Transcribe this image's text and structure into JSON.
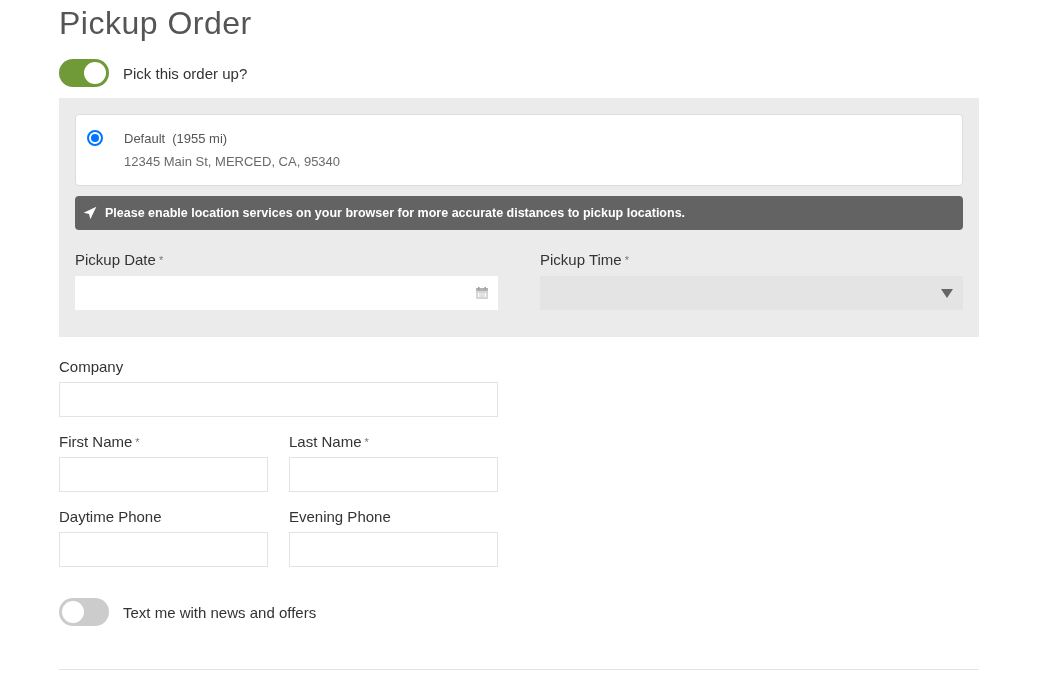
{
  "title": "Pickup Order",
  "pickup_toggle": {
    "label": "Pick this order up?",
    "on": true
  },
  "pickup_panel": {
    "locations": [
      {
        "name": "Default",
        "distance": "(1955 mi)",
        "address": "12345 Main St, MERCED, CA, 95340",
        "selected": true
      }
    ],
    "notice": "Please enable location services on your browser for more accurate distances to pickup locations.",
    "fields": [
      {
        "label": "Pickup Date",
        "required_mark": "*",
        "kind": "date",
        "disabled": false
      },
      {
        "label": "Pickup Time",
        "required_mark": "*",
        "kind": "select",
        "disabled": true
      }
    ]
  },
  "contact_rows": [
    {
      "fields": [
        {
          "label": "Company"
        }
      ]
    },
    {
      "fields": [
        {
          "label": "First Name",
          "required_mark": "*"
        },
        {
          "label": "Last Name",
          "required_mark": "*"
        }
      ]
    },
    {
      "fields": [
        {
          "label": "Daytime Phone"
        },
        {
          "label": "Evening Phone"
        }
      ]
    }
  ],
  "sms_toggle": {
    "label": "Text me with news and offers",
    "on": false
  }
}
